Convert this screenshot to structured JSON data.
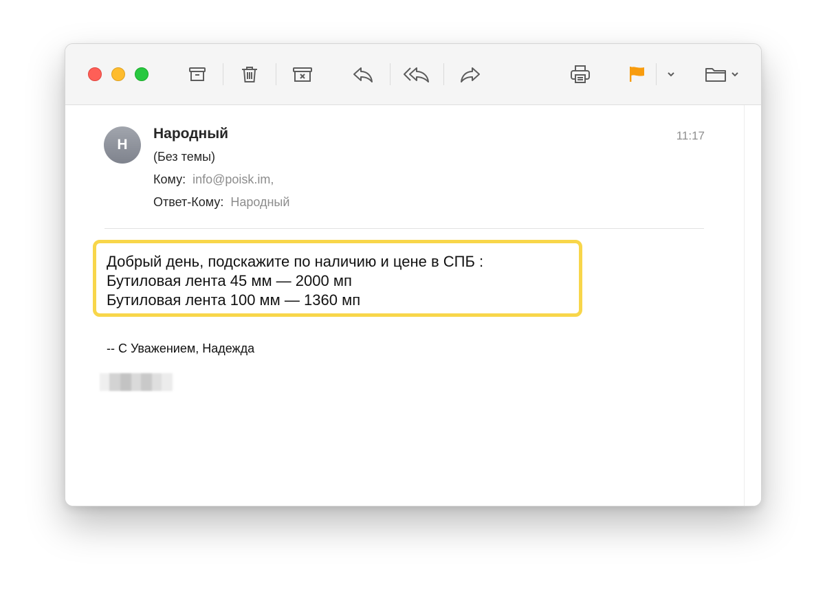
{
  "toolbar": {
    "icons": [
      "archive-icon",
      "trash-icon",
      "junk-icon",
      "reply-icon",
      "reply-all-icon",
      "forward-icon",
      "print-icon",
      "flag-icon",
      "chevron-down-icon",
      "folder-icon"
    ],
    "flag_color": "#f89c0e"
  },
  "message": {
    "avatar_initial": "Н",
    "sender": "Народный",
    "subject": "(Без темы)",
    "to_label": "Кому:",
    "to_value": "info@poisk.im,",
    "reply_to_label": "Ответ-Кому:",
    "reply_to_value": "Народный",
    "time": "11:17"
  },
  "body": {
    "lines": [
      "Добрый день, подскажите по наличию и цене в СПБ :",
      "Бутиловая лента 45 мм — 2000 мп",
      "Бутиловая лента 100 мм — 1360 мп"
    ],
    "signature": "-- С Уважением, Надежда"
  },
  "colors": {
    "highlight_border": "#f8d64a",
    "close": "#fe5f57",
    "minimize": "#febc2e",
    "zoom": "#28c840"
  }
}
